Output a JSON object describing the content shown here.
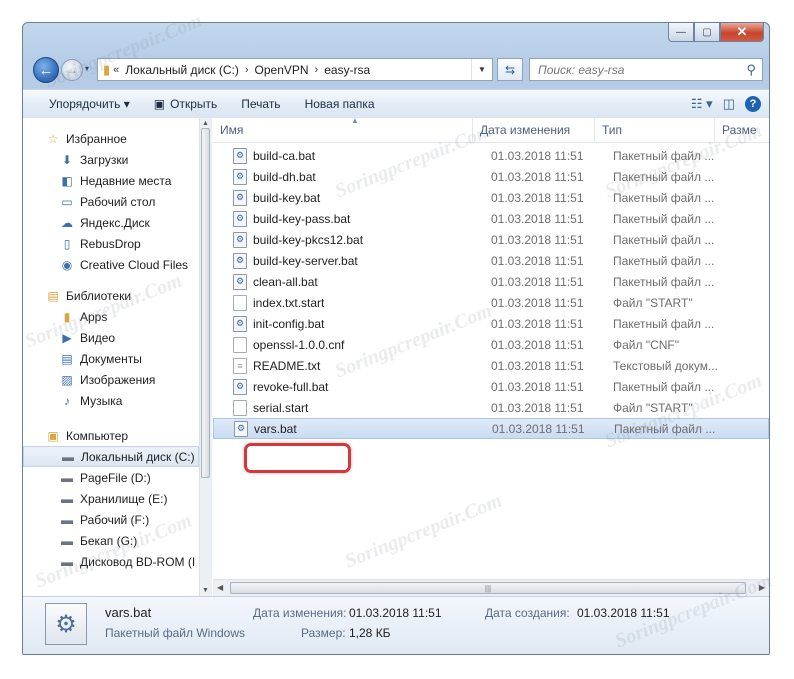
{
  "window": {
    "caption_buttons": {
      "minimize": "—",
      "maximize": "▢",
      "close": "✕"
    }
  },
  "nav": {
    "back_glyph": "←",
    "forward_glyph": "→",
    "history_glyph": "▾",
    "breadcrumb": [
      "Локальный диск (C:)",
      "OpenVPN",
      "easy-rsa"
    ],
    "breadcrumb_prefix": "«",
    "separator": "›",
    "search_placeholder": "Поиск: easy-rsa"
  },
  "toolbar": {
    "organize": "Упорядочить ▾",
    "open": "Открыть",
    "print": "Печать",
    "new_folder": "Новая папка"
  },
  "sidebar": {
    "favorites": {
      "label": "Избранное",
      "items": [
        "Загрузки",
        "Недавние места",
        "Рабочий стол",
        "Яндекс.Диск",
        "RebusDrop",
        "Creative Cloud Files"
      ]
    },
    "libraries": {
      "label": "Библиотеки",
      "items": [
        "Apps",
        "Видео",
        "Документы",
        "Изображения",
        "Музыка"
      ]
    },
    "computer": {
      "label": "Компьютер",
      "items": [
        "Локальный диск (C:)",
        "PageFile (D:)",
        "Хранилище (E:)",
        "Рабочий (F:)",
        "Бекап (G:)",
        "Дисковод BD-ROM (I"
      ]
    }
  },
  "columns": {
    "name": "Имя",
    "date": "Дата изменения",
    "type": "Тип",
    "size": "Разме"
  },
  "files": [
    {
      "name": "build-ca.bat",
      "date": "01.03.2018 11:51",
      "type": "Пакетный файл ...",
      "icon": "bat-icon"
    },
    {
      "name": "build-dh.bat",
      "date": "01.03.2018 11:51",
      "type": "Пакетный файл ...",
      "icon": "bat-icon"
    },
    {
      "name": "build-key.bat",
      "date": "01.03.2018 11:51",
      "type": "Пакетный файл ...",
      "icon": "bat-icon"
    },
    {
      "name": "build-key-pass.bat",
      "date": "01.03.2018 11:51",
      "type": "Пакетный файл ...",
      "icon": "bat-icon"
    },
    {
      "name": "build-key-pkcs12.bat",
      "date": "01.03.2018 11:51",
      "type": "Пакетный файл ...",
      "icon": "bat-icon"
    },
    {
      "name": "build-key-server.bat",
      "date": "01.03.2018 11:51",
      "type": "Пакетный файл ...",
      "icon": "bat-icon"
    },
    {
      "name": "clean-all.bat",
      "date": "01.03.2018 11:51",
      "type": "Пакетный файл ...",
      "icon": "bat-icon"
    },
    {
      "name": "index.txt.start",
      "date": "01.03.2018 11:51",
      "type": "Файл \"START\"",
      "icon": "file-icon"
    },
    {
      "name": "init-config.bat",
      "date": "01.03.2018 11:51",
      "type": "Пакетный файл ...",
      "icon": "bat-icon"
    },
    {
      "name": "openssl-1.0.0.cnf",
      "date": "01.03.2018 11:51",
      "type": "Файл \"CNF\"",
      "icon": "file-icon"
    },
    {
      "name": "README.txt",
      "date": "01.03.2018 11:51",
      "type": "Текстовый докум...",
      "icon": "text-file-icon"
    },
    {
      "name": "revoke-full.bat",
      "date": "01.03.2018 11:51",
      "type": "Пакетный файл ...",
      "icon": "bat-icon"
    },
    {
      "name": "serial.start",
      "date": "01.03.2018 11:51",
      "type": "Файл \"START\"",
      "icon": "file-icon"
    },
    {
      "name": "vars.bat",
      "date": "01.03.2018 11:51",
      "type": "Пакетный файл ...",
      "icon": "bat-icon",
      "selected": true
    }
  ],
  "details": {
    "name": "vars.bat",
    "type": "Пакетный файл Windows",
    "modified_label": "Дата изменения:",
    "modified_value": "01.03.2018 11:51",
    "size_label": "Размер:",
    "size_value": "1,28 КБ",
    "created_label": "Дата создания:",
    "created_value": "01.03.2018 11:51"
  },
  "watermark": "Soringpcrepair.Com",
  "colors": {
    "selection": "#cfe0f4",
    "highlight_frame": "#d4383e",
    "chrome": "#b6cce6"
  }
}
